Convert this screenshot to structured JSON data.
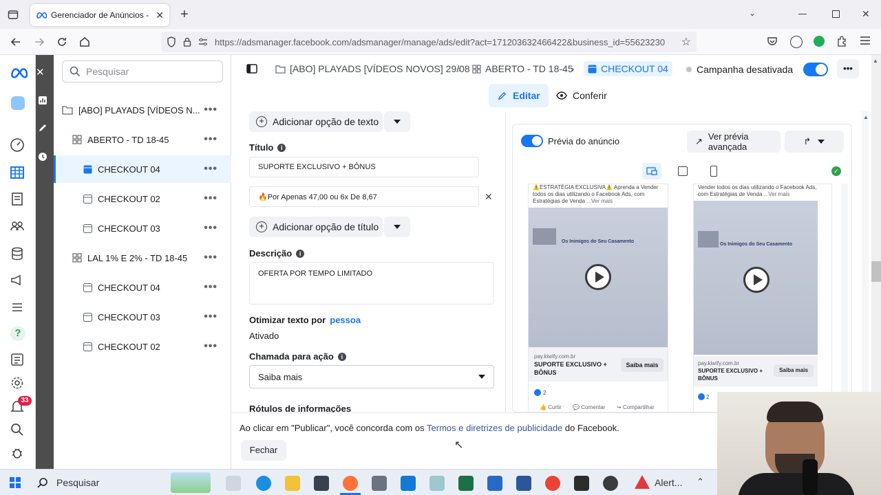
{
  "browser": {
    "tab_title": "Gerenciador de Anúncios - Gere",
    "url": "https://adsmanager.facebook.com/adsmanager/manage/ads/edit?act=171203632466422&business_id=55623230"
  },
  "search": {
    "placeholder": "Pesquisar"
  },
  "tree": [
    {
      "label": "[ABO] PLAYADS [VÍDEOS N...",
      "kind": "campaign"
    },
    {
      "label": "ABERTO - TD 18-45",
      "kind": "adset"
    },
    {
      "label": "CHECKOUT 04",
      "kind": "ad",
      "selected": true
    },
    {
      "label": "CHECKOUT 02",
      "kind": "ad"
    },
    {
      "label": "CHECKOUT 03",
      "kind": "ad"
    },
    {
      "label": "LAL 1% E 2% - TD 18-45",
      "kind": "adset"
    },
    {
      "label": "CHECKOUT 04",
      "kind": "ad"
    },
    {
      "label": "CHECKOUT 03",
      "kind": "ad"
    },
    {
      "label": "CHECKOUT 02",
      "kind": "ad"
    }
  ],
  "breadcrumb": {
    "campaign": "[ABO] PLAYADS [VÍDEOS NOVOS] 29/08",
    "adset": "ABERTO - TD 18-45",
    "ad": "CHECKOUT 04",
    "status": "Campanha desativada"
  },
  "modes": {
    "edit": "Editar",
    "review": "Conferir"
  },
  "form": {
    "add_text_option": "Adicionar opção de texto",
    "title_label": "Título",
    "title_value_1": "SUPORTE EXCLUSIVO + BÔNUS",
    "title_value_2": "🔥Por Apenas 47,00 ou 6x De 8,67",
    "add_title_option": "Adicionar opção de título",
    "description_label": "Descrição",
    "description_value": "OFERTA POR TEMPO LIMITADO",
    "optimize_text": "Otimizar texto por",
    "optimize_link": "pessoa",
    "optimize_status": "Ativado",
    "cta_label": "Chamada para ação",
    "cta_value": "Saiba mais",
    "info_labels": "Rótulos de informações"
  },
  "preview": {
    "toggle_label": "Prévia do anúncio",
    "advanced": "Ver prévia avançada",
    "card1": {
      "text": "⚠️ESTRATÉGIA EXCLUSIVA⚠️ Aprenda a Vender todos os dias utilizando o Facebook Ads, com Estratégias de Venda",
      "more": "...Ver mais",
      "video_title": "Os Inimigos do Seu Casamento",
      "domain": "pay.kiwify.com.br",
      "headline": "SUPORTE EXCLUSIVO + BÔNUS",
      "button": "Saiba mais",
      "reactions": "2",
      "like": "Curtir",
      "comment": "Comentar",
      "share": "Compartilhar"
    },
    "card2": {
      "text": "Vender todos os dias utilizando o Facebook Ads, com Estratégias de Venda",
      "more": "...Ver mais",
      "video_title": "Os Inimigos do Seu Casamento",
      "domain": "pay.kiwify.com.br",
      "headline": "SUPORTE EXCLUSIVO + BÔNUS",
      "button": "Saiba mais",
      "reactions": "2"
    }
  },
  "footer": {
    "terms_prefix": "Ao clicar em \"Publicar\", você concorda com os",
    "terms_link": "Termos e diretrizes de publicidade",
    "terms_suffix": "do Facebook.",
    "close": "Fechar"
  },
  "rail": {
    "notifications": "33"
  },
  "taskbar": {
    "search": "Pesquisar",
    "alert": "Alert..."
  },
  "colors": {
    "accent": "#1877f2",
    "toggle": "#1877f2",
    "success": "#31a24c"
  }
}
